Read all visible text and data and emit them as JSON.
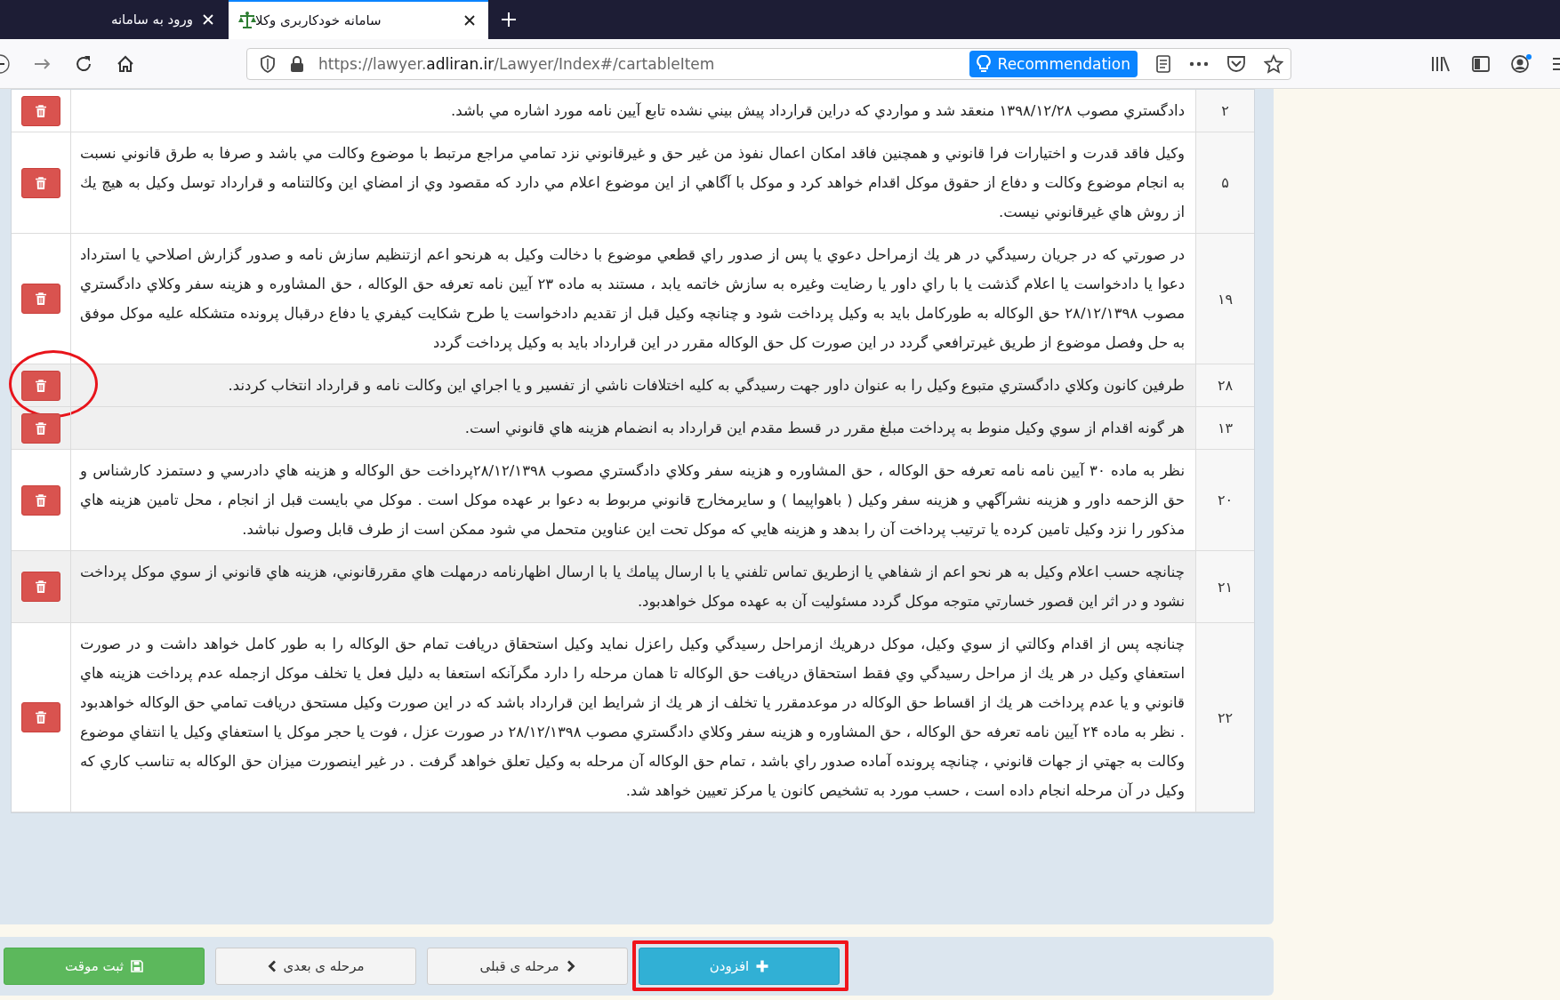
{
  "browser": {
    "tabs": [
      {
        "title": "سامانه خودکاربری وکلا",
        "selected": true
      },
      {
        "title": "ورود به سامانه",
        "selected": false
      }
    ],
    "url": "https://lawyer.**adliran.ir**/Lawyer/Index#/cartableItem",
    "recommendation": "Recommendation"
  },
  "table": {
    "rows": [
      {
        "number": "۲",
        "text": "دادگستري مصوب ۱۳۹۸/۱۲/۲۸ منعقد شد و مواردي که دراين قرارداد پيش بيني نشده تابع آيين نامه مورد اشاره مي باشد.",
        "shaded": false,
        "annotated": false
      },
      {
        "number": "۵",
        "text": "وکيل فاقد قدرت و اختيارات فرا قانوني و همچنين فاقد امکان اعمال نفوذ من غير حق و غيرقانوني نزد تمامي مراجع مرتبط با موضوع وکالت مي باشد و صرفا به طرق قانوني نسبت به انجام موضوع وکالت و دفاع از حقوق موکل اقدام خواهد کرد و موکل با آگاهي از اين موضوع اعلام مي دارد که مقصود وي از امضاي اين وکالتنامه و قرارداد توسل وکيل به هيچ يك از روش هاي غيرقانوني نيست.",
        "shaded": false,
        "annotated": false
      },
      {
        "number": "۱۹",
        "text": "در صورتي که در جريان رسيدگي در هر يك ازمراحل دعوي يا پس از صدور راي قطعي موضوع با دخالت وکيل به هرنحو اعم ازتنظيم سازش نامه و صدور گزارش اصلاحي يا استرداد دعوا يا دادخواست يا اعلام گذشت يا با راي داور يا رضايت وغيره به سازش خاتمه يابد ، مستند به ماده ۲۳ آيين نامه تعرفه حق الوکاله ، حق المشاوره و هزينه سفر وکلاي دادگستري مصوب ۲۸/۱۲/۱۳۹۸ حق الوکاله به طورکامل بايد به وکيل پرداخت شود و چنانچه وکيل قبل از تقديم دادخواست يا طرح شکايت کيفري يا دفاع درقبال پرونده متشکله عليه موکل موفق به حل وفصل موضوع از طريق غيرترافعي گردد در اين صورت کل حق الوکاله مقرر در اين قرارداد بايد به وکيل پرداخت گردد",
        "shaded": false,
        "annotated": false
      },
      {
        "number": "۲۸",
        "text": "طرفين کانون وکلاي دادگستري متبوع وکيل را به عنوان داور جهت رسيدگي به کليه اختلافات ناشي از تفسير و يا اجراي اين وکالت نامه و قرارداد انتخاب کردند.",
        "shaded": true,
        "annotated": true
      },
      {
        "number": "۱۳",
        "text": "هر گونه اقدام از سوي وکيل منوط به پرداخت مبلغ مقرر در قسط مقدم اين قرارداد به انضمام هزينه هاي قانوني است.",
        "shaded": true,
        "annotated": false
      },
      {
        "number": "۲۰",
        "text": "نظر به ماده ۳۰ آيين نامه نامه تعرفه حق الوکاله ، حق المشاوره و هزينه سفر وکلاي دادگستري مصوب ۲۸/۱۲/۱۳۹۸پرداخت حق الوکاله و هزينه هاي دادرسي و دستمزد کارشناس و حق الزحمه داور و هزينه نشرآگهي و هزينه سفر وکيل ( باهواپيما ) و سايرمخارج قانوني مربوط به دعوا بر عهده موکل است . موکل مي بايست قبل از انجام ، محل تامين هزينه هاي مذکور را نزد وکيل تامين کرده يا ترتيب پرداخت آن را بدهد و هزينه هايي که موکل تحت اين عناوين متحمل مي شود ممکن است از طرف قابل وصول نباشد.",
        "shaded": false,
        "annotated": false
      },
      {
        "number": "۲۱",
        "text": "چنانچه حسب اعلام وکيل به هر نحو اعم از شفاهي يا ازطريق تماس تلفني يا با ارسال پيامك يا با ارسال اظهارنامه درمهلت هاي مقررقانوني، هزينه هاي قانوني از سوي موکل پرداخت نشود و در اثر اين قصور خسارتي متوجه موکل گردد مسئوليت آن به عهده موکل خواهدبود.",
        "shaded": true,
        "annotated": false
      },
      {
        "number": "۲۲",
        "text": "چنانچه پس از اقدام وکالتي از سوي وکيل، موکل درهريك ازمراحل رسيدگي وکيل راعزل نمايد وکيل استحقاق دريافت تمام حق الوکاله را به طور کامل خواهد داشت و در صورت استعفاي وکيل در هر يك از مراحل رسيدگي وي فقط استحقاق دريافت حق الوکاله تا همان مرحله را دارد مگرآنکه استعفا به دليل فعل يا تخلف موکل ازجمله عدم پرداخت هزينه هاي قانوني و يا عدم پرداخت هر يك از اقساط حق الوکاله در موعدمقرر يا تخلف از هر يك از شرايط اين قرارداد باشد که در اين صورت وکيل مستحق دريافت تمامي حق الوکاله خواهدبود . نظر به ماده ۲۴ آيين نامه تعرفه حق الوکاله ، حق المشاوره و هزينه سفر وکلاي دادگستري مصوب ۲۸/۱۲/۱۳۹۸ در صورت عزل ، فوت يا حجر موکل يا استعفاي وکيل يا انتفاي موضوع وکالت به جهتي از جهات قانوني ، چنانچه پرونده آماده صدور راي باشد ، تمام حق الوکاله آن مرحله به وکيل تعلق خواهد گرفت . در غير اينصورت ميزان حق الوکاله به تناسب کاري که وکيل در آن مرحله انجام داده است ، حسب مورد به تشخيص کانون يا مرکز تعيين خواهد شد.",
        "shaded": false,
        "annotated": false
      }
    ]
  },
  "buttons": [
    {
      "kind": "add",
      "label": "افزودن",
      "annotated": true
    },
    {
      "kind": "prev",
      "label": "مرحله ی قبلی",
      "annotated": false
    },
    {
      "kind": "next",
      "label": "مرحله ی بعدی",
      "annotated": false
    },
    {
      "kind": "save",
      "label": "ثبت موقت",
      "annotated": false
    }
  ]
}
